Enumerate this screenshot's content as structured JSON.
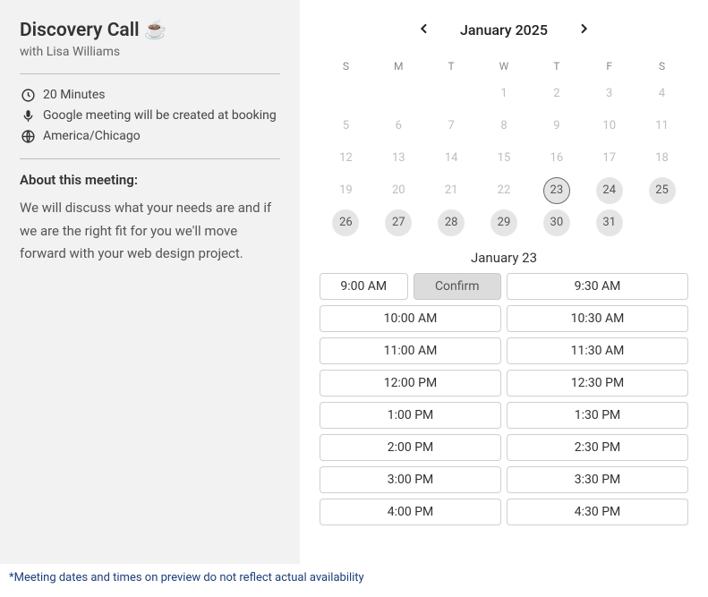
{
  "sidebar": {
    "title": "Discovery Call ☕",
    "host_prefix": "with ",
    "host_name": "Lisa Williams",
    "duration": "20 Minutes",
    "meeting_provider": "Google meeting will be created at booking",
    "timezone": "America/Chicago",
    "about_heading": "About this meeting:",
    "about_body": "We will discuss what your needs are and if we are the right fit for you we'll move forward with your web design project."
  },
  "calendar": {
    "month_label": "January 2025",
    "day_initials": [
      "S",
      "M",
      "T",
      "W",
      "T",
      "F",
      "S"
    ],
    "weeks": [
      [
        null,
        null,
        null,
        {
          "d": 1,
          "avail": false
        },
        {
          "d": 2,
          "avail": false
        },
        {
          "d": 3,
          "avail": false
        },
        {
          "d": 4,
          "avail": false
        }
      ],
      [
        {
          "d": 5,
          "avail": false
        },
        {
          "d": 6,
          "avail": false
        },
        {
          "d": 7,
          "avail": false
        },
        {
          "d": 8,
          "avail": false
        },
        {
          "d": 9,
          "avail": false
        },
        {
          "d": 10,
          "avail": false
        },
        {
          "d": 11,
          "avail": false
        }
      ],
      [
        {
          "d": 12,
          "avail": false
        },
        {
          "d": 13,
          "avail": false
        },
        {
          "d": 14,
          "avail": false
        },
        {
          "d": 15,
          "avail": false
        },
        {
          "d": 16,
          "avail": false
        },
        {
          "d": 17,
          "avail": false
        },
        {
          "d": 18,
          "avail": false
        }
      ],
      [
        {
          "d": 19,
          "avail": false
        },
        {
          "d": 20,
          "avail": false
        },
        {
          "d": 21,
          "avail": false
        },
        {
          "d": 22,
          "avail": false
        },
        {
          "d": 23,
          "avail": true,
          "selected": true
        },
        {
          "d": 24,
          "avail": true
        },
        {
          "d": 25,
          "avail": true
        }
      ],
      [
        {
          "d": 26,
          "avail": true
        },
        {
          "d": 27,
          "avail": true
        },
        {
          "d": 28,
          "avail": true
        },
        {
          "d": 29,
          "avail": true
        },
        {
          "d": 30,
          "avail": true
        },
        {
          "d": 31,
          "avail": true
        },
        null
      ]
    ],
    "selected_date_label": "January 23",
    "confirm_label": "Confirm",
    "time_rows": [
      {
        "left": "9:00 AM",
        "left_selected": true,
        "right": "9:30 AM"
      },
      {
        "left": "10:00 AM",
        "right": "10:30 AM"
      },
      {
        "left": "11:00 AM",
        "right": "11:30 AM"
      },
      {
        "left": "12:00 PM",
        "right": "12:30 PM"
      },
      {
        "left": "1:00 PM",
        "right": "1:30 PM"
      },
      {
        "left": "2:00 PM",
        "right": "2:30 PM"
      },
      {
        "left": "3:00 PM",
        "right": "3:30 PM"
      },
      {
        "left": "4:00 PM",
        "right": "4:30 PM"
      }
    ]
  },
  "footer": {
    "note": "*Meeting dates and times on preview do not reflect actual availability"
  }
}
